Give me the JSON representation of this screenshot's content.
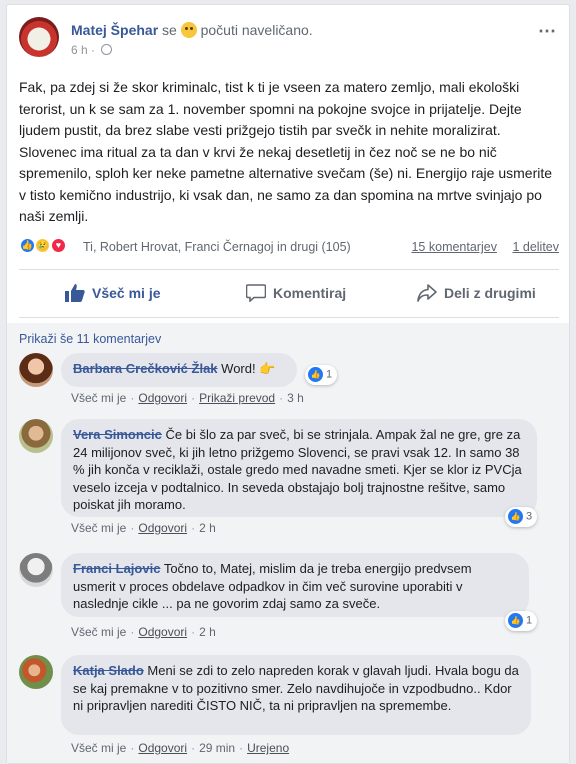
{
  "post": {
    "author": "Matej Špehar",
    "feeling_prefix": "se",
    "feeling": "počuti naveličano.",
    "time": "6 h",
    "more_icon": "⋯",
    "text": "Fak, pa zdej si že skor kriminalc, tist k ti je vseen za matero zemljo, mali ekološki terorist, un k se sam za 1. november spomni na pokojne svojce in prijatelje. Dejte ljudem pustit, da brez slabe vesti prižgejo tistih par svečk in nehite moralizirat. Slovenec ima ritual za ta dan v krvi že nekaj desetletij in čez noč se ne bo nič spremenilo, sploh ker neke pametne alternative svečam (še) ni. Energijo raje usmerite v tisto kemično industrijo, ki vsak dan, ne samo za dan spomina na mrtve svinjajo po naši zemlji.",
    "reactions_names": "Ti, Robert Hrovat, Franci Černagoj in drugi (105)",
    "comments_count": "15 komentarjev",
    "shares_count": "1 delitev"
  },
  "actions": {
    "like": "Všeč mi je",
    "comment": "Komentiraj",
    "share": "Deli z drugimi"
  },
  "comments_section": {
    "show_more": "Prikaži še 11 komentarjev",
    "like_label": "Všeč mi je",
    "reply_label": "Odgovori",
    "items": [
      {
        "author": "Barbara Crečković Žlak",
        "text": "Word! 👉",
        "time": "3 h",
        "extra": "Prikaži prevod",
        "reactions": "1"
      },
      {
        "author": "Vera Simoncic",
        "text": "Če bi šlo za par sveč, bi se strinjala. Ampak žal ne gre, gre za 24 milijonov sveč, ki jih letno prižgemo Slovenci, se pravi vsak 12. In samo 38 % jih konča v reciklaži, ostale gredo med navadne smeti. Kjer se klor iz PVCja veselo izceja v podtalnico. In seveda obstajajo bolj trajnostne rešitve, samo poiskat jih moramo.",
        "time": "2 h",
        "reactions": "3"
      },
      {
        "author": "Franci Lajovic",
        "text": "Točno to, Matej, mislim da je treba energijo predvsem usmerit v proces obdelave odpadkov in čim več surovine uporabiti v naslednje cikle ... pa ne govorim zdaj samo za sveče.",
        "time": "2 h",
        "reactions": "1"
      },
      {
        "author": "Katja Slado",
        "text": "Meni se zdi to zelo napreden korak v glavah ljudi. Hvala bogu da se kaj premakne v to pozitivno smer. Zelo navdihujoče in vzpodbudno.. Kdor ni pripravljen narediti ČISTO NIČ, ta ni pripravljen na spremembe.",
        "time": "29 min",
        "extra": "Urejeno"
      }
    ]
  }
}
